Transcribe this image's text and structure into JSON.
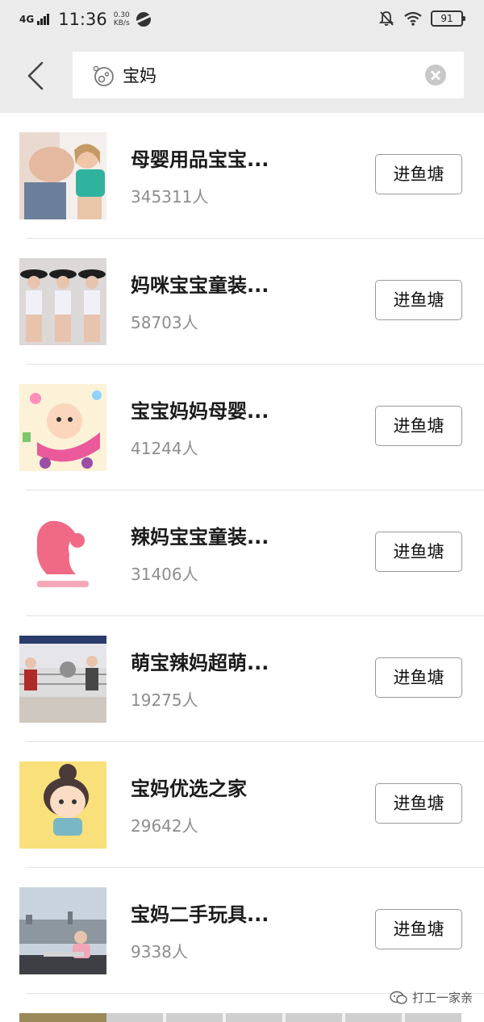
{
  "status_bar": {
    "network": "4G",
    "time": "11:36",
    "speed_value": "0.30",
    "speed_unit": "KB/s",
    "battery": "91"
  },
  "search": {
    "query": "宝妈"
  },
  "results": [
    {
      "title": "母婴用品宝宝...",
      "count": "345311人",
      "button": "进鱼塘"
    },
    {
      "title": "妈咪宝宝童装...",
      "count": "58703人",
      "button": "进鱼塘"
    },
    {
      "title": "宝宝妈妈母婴...",
      "count": "41244人",
      "button": "进鱼塘"
    },
    {
      "title": "辣妈宝宝童装...",
      "count": "31406人",
      "button": "进鱼塘"
    },
    {
      "title": "萌宝辣妈超萌...",
      "count": "19275人",
      "button": "进鱼塘"
    },
    {
      "title": "宝妈优选之家",
      "count": "29642人",
      "button": "进鱼塘"
    },
    {
      "title": "宝妈二手玩具...",
      "count": "9338人",
      "button": "进鱼塘"
    }
  ],
  "watermark": {
    "text": "打工一家亲"
  },
  "icons": {
    "back": "chevron-left-icon",
    "search": "fish-pond-search-icon",
    "clear": "clear-icon"
  },
  "colors": {
    "bar_background": "#ebebeb",
    "button_border": "#9a9a9a",
    "count_text": "#8d8d8d"
  }
}
